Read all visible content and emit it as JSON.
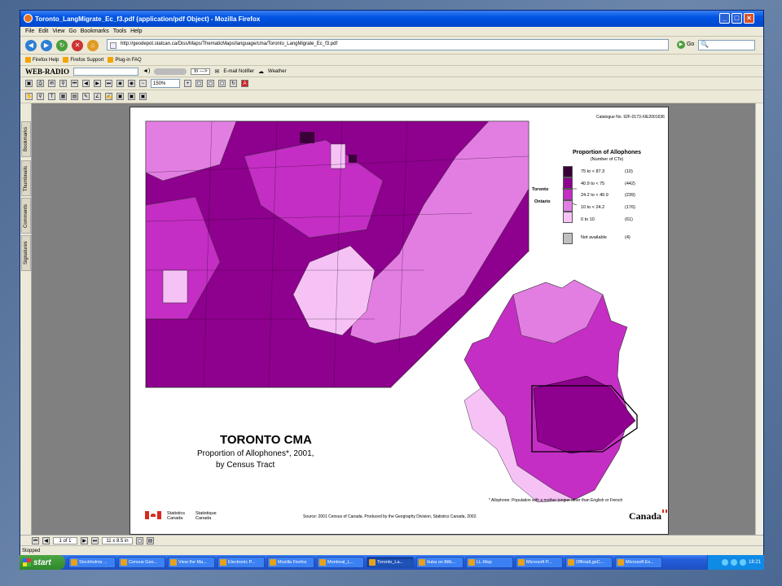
{
  "window": {
    "title": "Toronto_LangMigrate_Ec_f3.pdf (application/pdf Object) - Mozilla Firefox"
  },
  "menu": [
    "File",
    "Edit",
    "View",
    "Go",
    "Bookmarks",
    "Tools",
    "Help"
  ],
  "nav": {
    "url": "http://geodepot.statcan.ca/Diss/Maps/ThematicMaps/language/cma/Toronto_LangMigrate_Ec_f3.pdf",
    "go_label": "Go"
  },
  "bookmarks": [
    "Firefox Help",
    "Firefox Support",
    "Plug-in FAQ"
  ],
  "radiobar": {
    "brand": "WEB-RADIO",
    "inlabel": "In --->",
    "email": "E-mail Notifier",
    "weather": "Weather"
  },
  "pdf": {
    "zoom": "150%",
    "page_current": "1 of 1",
    "page_size": "11 x 8.5 in",
    "side_tabs": [
      "Bookmarks",
      "Thumbnails",
      "Comments",
      "Signatures"
    ]
  },
  "map": {
    "catalog": "Catalogue No. 92F-0173-XIE2001636",
    "title": "TORONTO CMA",
    "subtitle1": "Proportion of Allophones*, 2001,",
    "subtitle2": "by Census Tract",
    "legend": {
      "title": "Proportion of Allophones",
      "subtitle": "(Number of CTs)",
      "items": [
        {
          "range": "75 to < 87.3",
          "count": "(10)",
          "color": "#3a0038"
        },
        {
          "range": "40.9 to < 75",
          "count": "(442)",
          "color": "#8e008e"
        },
        {
          "range": "24.2 to < 40.9",
          "count": "(239)",
          "color": "#c42ec4"
        },
        {
          "range": "10 to < 24.2",
          "count": "(176)",
          "color": "#e27ee2"
        },
        {
          "range": "0 to 10",
          "count": "(61)",
          "color": "#f6c2f6"
        },
        {
          "range": "Not available",
          "count": "(4)",
          "color": "#c0c0c0"
        }
      ],
      "toronto": "Toronto",
      "ontario": "Ontario"
    },
    "footnote": "* Allophone: Population with a mother tongue other than English or French",
    "stat_en": "Statistics\nCanada",
    "stat_en1": "Statistics",
    "stat_en2": "Canada",
    "stat_fr1": "Statistique",
    "stat_fr2": "Canada",
    "source": "Source: 2001 Census of Canada. Produced by the Geography Division, Statistics Canada, 2002.",
    "wordmark": "Canada"
  },
  "status": "Stopped",
  "taskbar": {
    "start": "start",
    "tasks": [
      "Stockholms ...",
      "Census Geo...",
      "View the Ma...",
      "Electronic P...",
      "Mozilla Firefox",
      "Montreal_L...",
      "Toronto_La...",
      "Ituba on Bilb...",
      "LL-Map",
      "Microsoft P...",
      "OfficialLgsC...",
      "Microsoft Ex..."
    ],
    "clock": "18:21"
  }
}
